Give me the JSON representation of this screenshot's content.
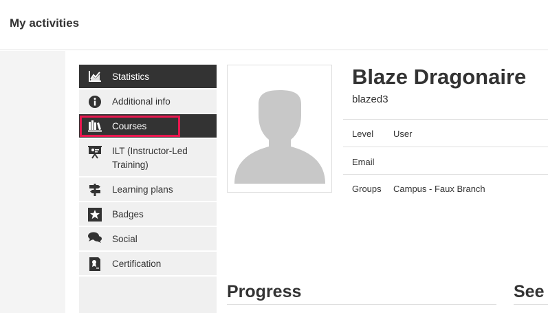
{
  "header": {
    "title": "My activities"
  },
  "sidebar": {
    "items": [
      {
        "label": "Statistics",
        "icon": "chart-icon"
      },
      {
        "label": "Additional info",
        "icon": "info-icon"
      },
      {
        "label": "Courses",
        "icon": "books-icon"
      },
      {
        "label": "ILT (Instructor-Led Training)",
        "icon": "presentation-icon"
      },
      {
        "label": "Learning plans",
        "icon": "signpost-icon"
      },
      {
        "label": "Badges",
        "icon": "star-icon"
      },
      {
        "label": "Social",
        "icon": "chat-icon"
      },
      {
        "label": "Certification",
        "icon": "certificate-icon"
      }
    ]
  },
  "profile": {
    "name": "Blaze Dragonaire",
    "username": "blazed3",
    "fields": [
      {
        "label": "Level",
        "value": "User"
      },
      {
        "label": "Email",
        "value": ""
      },
      {
        "label": "Groups",
        "value": "Campus - Faux Branch"
      }
    ]
  },
  "sections": {
    "progress_title": "Progress",
    "see_title": "See"
  },
  "colors": {
    "active_nav": "#333333",
    "highlight": "#e8174f",
    "nav_bg": "#f0f0f0"
  }
}
